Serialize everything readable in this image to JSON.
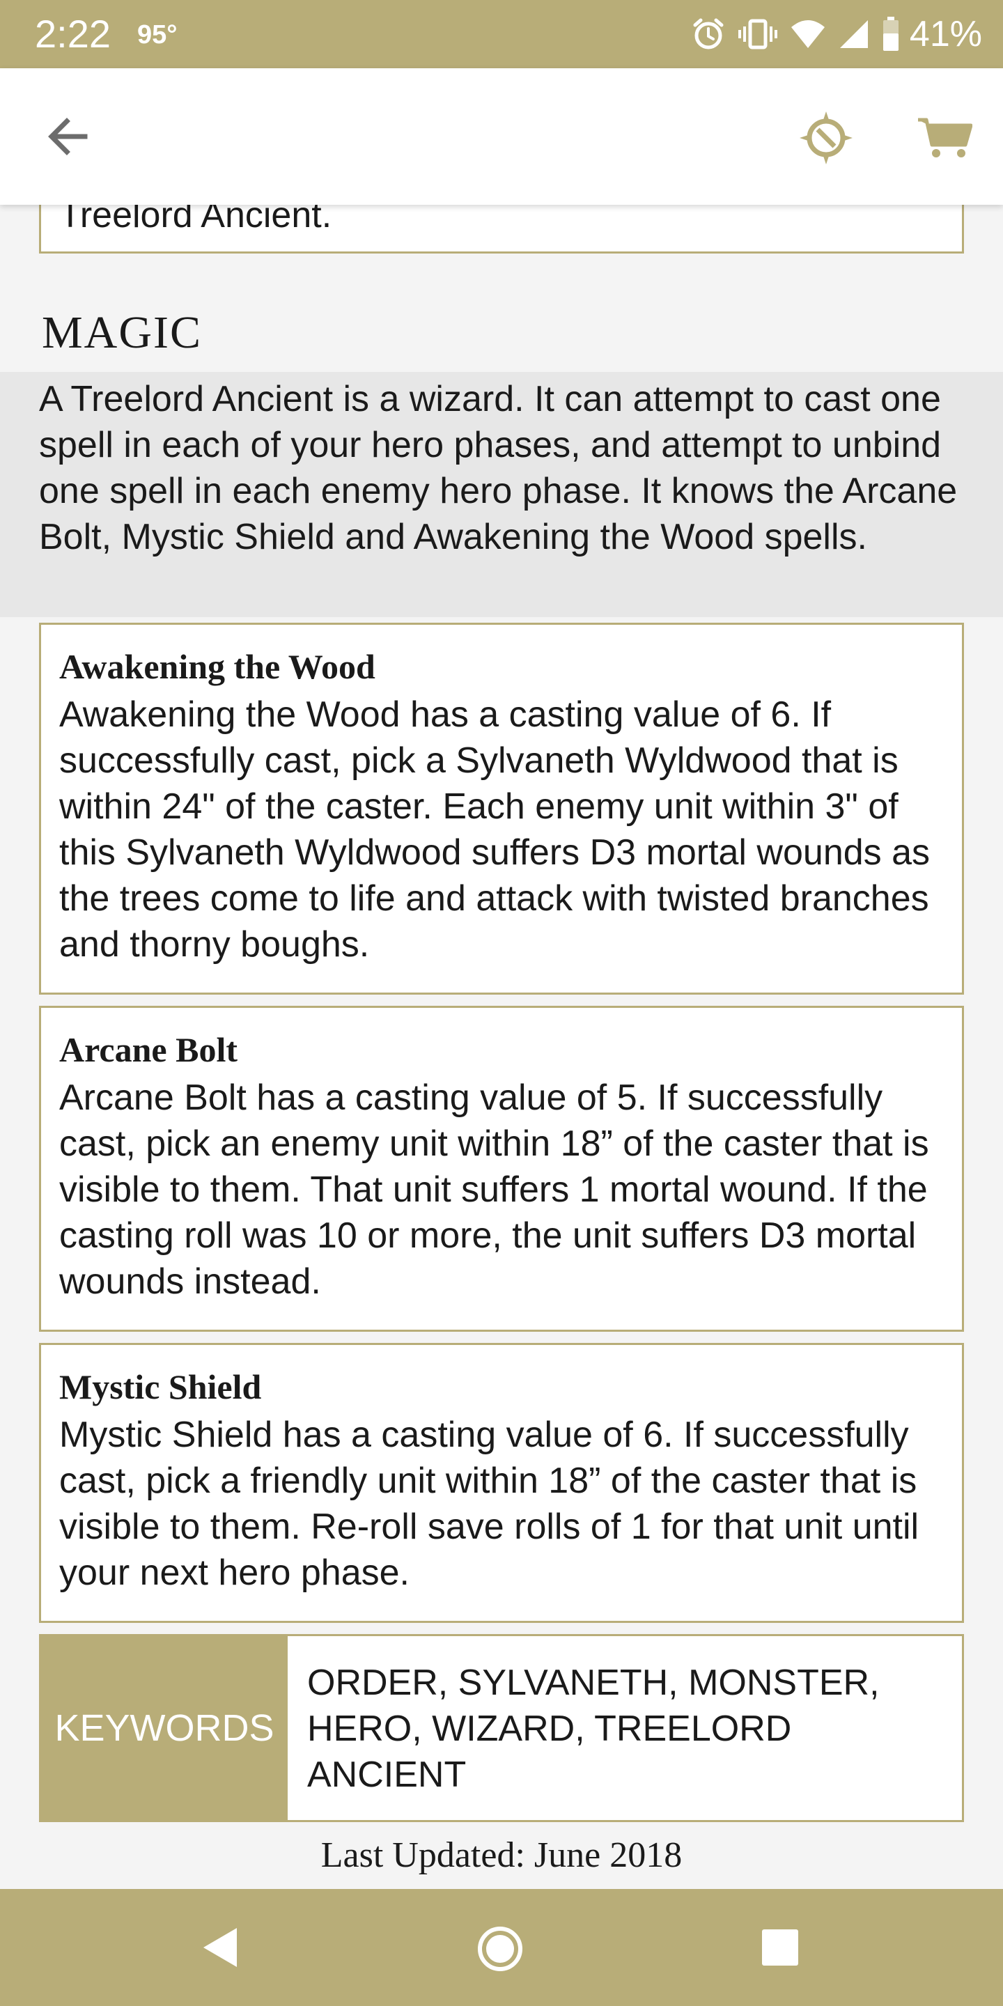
{
  "status_bar": {
    "time": "2:22",
    "temperature": "95°",
    "battery": "41%",
    "icons": [
      "alarm-icon",
      "vibrate-icon",
      "wifi-icon",
      "signal-icon",
      "battery-icon"
    ]
  },
  "app_bar": {
    "icons": [
      "back-arrow-icon",
      "compass-icon",
      "cart-icon"
    ]
  },
  "content": {
    "previous_card_text": "Treelord Ancient.",
    "magic": {
      "title": "MAGIC",
      "intro": "A Treelord Ancient is a wizard. It can attempt to cast one spell in each of your hero phases, and attempt to unbind one spell in each enemy hero phase. It knows the Arcane Bolt, Mystic Shield and Awakening the Wood spells."
    },
    "spells": [
      {
        "name": "Awakening the Wood",
        "description": "Awakening the Wood has a casting value of 6. If successfully cast, pick a Sylvaneth Wyldwood that is within 24\" of the caster. Each enemy unit within 3\" of this Sylvaneth Wyldwood suffers D3 mortal wounds as the trees come to life and attack with twisted branches and thorny boughs."
      },
      {
        "name": "Arcane Bolt",
        "description": "Arcane Bolt has a casting value of 5. If successfully cast, pick an enemy unit within 18” of the caster that is visible to them. That unit suffers 1 mortal wound. If the casting roll was 10 or more, the unit suffers D3 mortal wounds instead."
      },
      {
        "name": "Mystic Shield",
        "description": "Mystic Shield has a casting value of 6. If successfully cast, pick a friendly unit within 18” of the caster that is visible to them. Re-roll save rolls of 1 for that unit until your next hero phase."
      }
    ],
    "keywords": {
      "label": "KEYWORDS",
      "values": "ORDER, SYLVANETH, MONSTER, HERO, WIZARD, TREELORD ANCIENT"
    },
    "last_updated": "Last Updated: June 2018"
  },
  "nav_bar": {
    "icons": [
      "back-triangle-icon",
      "home-circle-icon",
      "recents-square-icon"
    ]
  },
  "colors": {
    "accent": "#b8ad78",
    "status_bar": "#b8ad78",
    "intro_background": "#e7e7e7",
    "page_background": "#f4f4f4",
    "card_background": "#ffffff"
  }
}
